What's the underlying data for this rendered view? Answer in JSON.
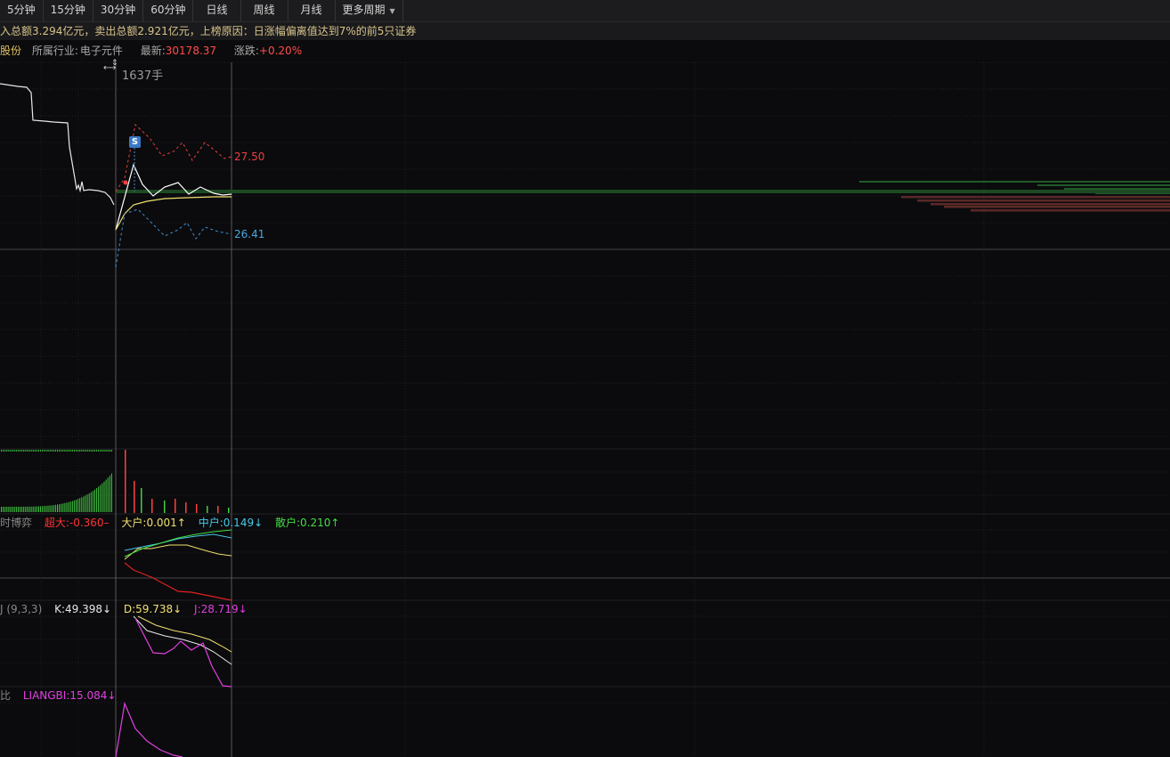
{
  "tabs": [
    "5分钟",
    "15分钟",
    "30分钟",
    "60分钟",
    "日线",
    "周线",
    "月线",
    "更多周期"
  ],
  "info_text": "入总额3.294亿元，卖出总额2.921亿元，上榜原因：日涨幅偏离值达到7%的前5只证券",
  "stock": {
    "name": "股份",
    "industry_label": "所属行业:",
    "industry": "电子元件",
    "latest_label": "最新:",
    "latest": "30178.37",
    "change_label": "涨跌:",
    "change": "+0.20%"
  },
  "main_chart": {
    "volume_label": "1637手",
    "high_label": "27.50",
    "low_label": "26.41",
    "signal_badge": "S"
  },
  "fund_flow": {
    "name": "时博弈",
    "super_large": "超大:-0.360–",
    "large": "大户:0.001↑",
    "medium": "中户:0.149↓",
    "retail": "散户:0.210↑"
  },
  "kdj": {
    "name": "J (9,3,3)",
    "k": "K:49.398↓",
    "d": "D:59.738↓",
    "j": "J:28.719↓"
  },
  "liangbi": {
    "name": "比",
    "value": "LIANGBI:15.084↓"
  },
  "colors": {
    "background": "#0b0b0d",
    "grid": "#2a2a2e",
    "up": "#ff4d4d",
    "down": "#44dd44",
    "avg_line": "#f0e070",
    "price_line": "#ffffff"
  }
}
